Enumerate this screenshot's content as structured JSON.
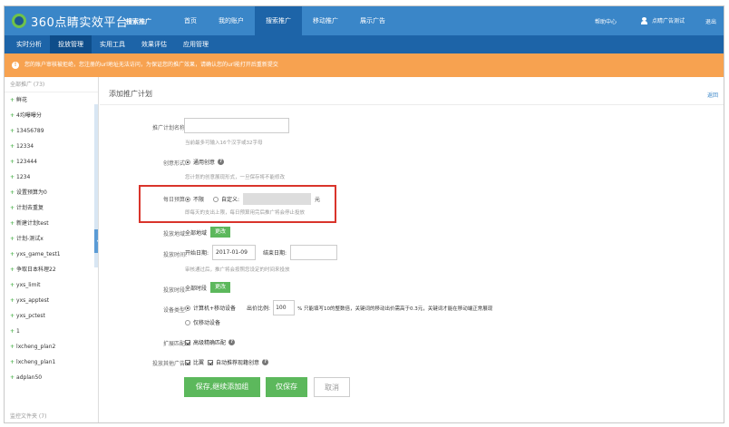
{
  "header": {
    "logo_text": "360点睛实效平台",
    "product": "搜索推广",
    "nav": [
      "首页",
      "我的账户",
      "搜索推广",
      "移动推广",
      "展示广告"
    ],
    "help": "帮助中心",
    "user": "点睛广告测试",
    "logout": "退出"
  },
  "subnav": [
    "实时分析",
    "投放管理",
    "实用工具",
    "效果评估",
    "应用管理"
  ],
  "warning": "您的账户审核被拒绝，您注册的url地址无法访问，为保证您的推广效果，请确认您的url能打开后重新提交",
  "sidebar": {
    "header": "全部推广 (73)",
    "items": [
      "鲜花",
      "4均曝曝分",
      "13456789",
      "12334",
      "123444",
      "1234",
      "设置预算为0",
      "计划去重复",
      "新建计划test",
      "计划-测试x",
      "yxs_game_test1",
      "争取日本科理22",
      "yxs_limit",
      "yxs_apptest",
      "yxs_pctest",
      "1",
      "lxcheng_plan2",
      "lxcheng_plan1",
      "adplan50"
    ],
    "footer": "监控文件夹 (7)"
  },
  "main": {
    "title": "添加推广计划",
    "back": "返回",
    "plan_name_label": "推广计划名称:",
    "plan_name_hint": "当前最多可输入16个汉字或32字母",
    "creative_label": "创意形式:",
    "creative_value": "通用创意",
    "creative_hint": "您计划的创意展现形式，一旦保存将不能修改",
    "budget_label": "每日预算:",
    "budget_unlimited": "不限",
    "budget_custom": "自定义:",
    "budget_unit": "元",
    "budget_hint": "即每天的支出上限，每日预算用完后推广将会停止投放",
    "region_label": "投放地域:",
    "region_value": "全部地域",
    "change_label": "更改",
    "time_label": "投放时间:",
    "start_label": "开始日期:",
    "start_value": "2017-01-09",
    "end_label": "结束日期:",
    "time_hint": "审核通过后，推广将会按照您设定的时间来投放",
    "period_label": "投放时段:",
    "period_value": "全部时段",
    "device_label": "设备类型:",
    "device_pc": "计算机+移动设备",
    "bid_ratio_label": "出价比例:",
    "bid_ratio_value": "100",
    "bid_ratio_hint": "% 只能填写10的整数倍，关键词的移动出价需高于0.3元，关键词才能在移动端正常展现",
    "device_mobile": "仅移动设备",
    "match_label": "扩展匹配:",
    "match_value": "高级精确匹配",
    "other_label": "投放其他广告:",
    "other_bid": "比翼",
    "other_recommend": "自动推荐现籍创意",
    "save_add": "保存,继续添加组",
    "save": "仅保存",
    "cancel": "取消"
  },
  "colors": {
    "primary": "#3a86c8",
    "dark_nav": "#1d64a8",
    "warning": "#f7a250",
    "green": "#5cb85c",
    "highlight": "#d9342b"
  }
}
